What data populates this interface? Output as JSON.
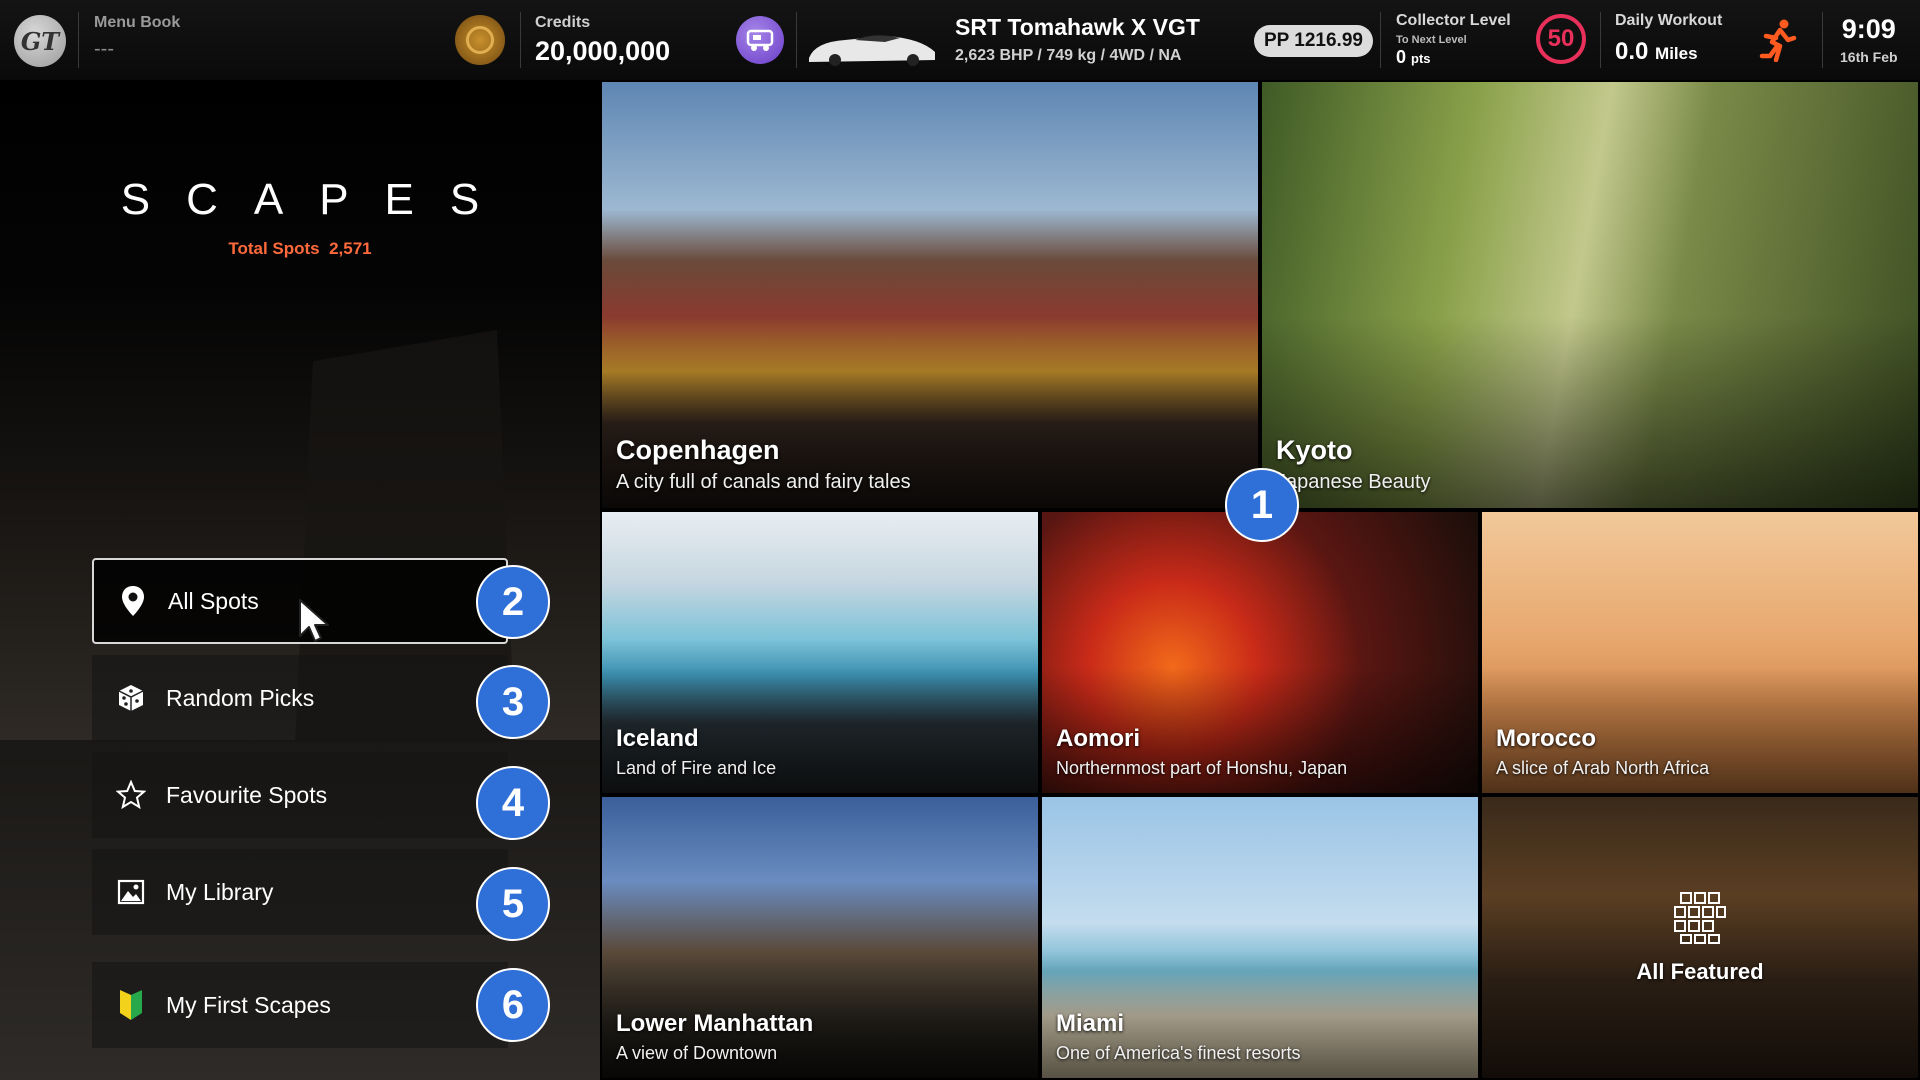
{
  "topbar": {
    "logo_text": "GT",
    "menu_book_label": "Menu Book",
    "menu_book_value": "---",
    "credits_label": "Credits",
    "credits_value": "20,000,000",
    "car_name": "SRT Tomahawk X VGT",
    "car_spec": "2,623 BHP / 749 kg / 4WD / NA",
    "pp_value": "PP 1216.99",
    "collector_label": "Collector Level",
    "collector_sub": "To Next Level",
    "collector_pts": "0",
    "collector_pts_unit": "pts",
    "collector_level": "50",
    "workout_label": "Daily Workout",
    "workout_value": "0.0",
    "workout_unit": "Miles",
    "time": "9:09",
    "date": "16th Feb"
  },
  "scapes": {
    "title": "SCAPES",
    "total_label": "Total Spots",
    "total_value": "2,571"
  },
  "menu": [
    {
      "label": "All Spots",
      "icon": "map-pin-icon",
      "badge": "2"
    },
    {
      "label": "Random Picks",
      "icon": "dice-icon",
      "badge": "3"
    },
    {
      "label": "Favourite Spots",
      "icon": "star-icon",
      "badge": "4"
    },
    {
      "label": "My Library",
      "icon": "image-icon",
      "badge": "5"
    },
    {
      "label": "My First Scapes",
      "icon": "beginner-leaf-icon",
      "badge": "6"
    }
  ],
  "tiles": [
    {
      "name": "Copenhagen",
      "desc": "A city full of canals and fairy tales"
    },
    {
      "name": "Kyoto",
      "desc": "Japanese Beauty"
    },
    {
      "name": "Iceland",
      "desc": "Land of Fire and Ice"
    },
    {
      "name": "Aomori",
      "desc": "Northernmost part of Honshu, Japan"
    },
    {
      "name": "Morocco",
      "desc": "A slice of Arab North Africa"
    },
    {
      "name": "Lower Manhattan",
      "desc": "A view of Downtown"
    },
    {
      "name": "Miami",
      "desc": "One of America's finest resorts"
    },
    {
      "name": "All Featured",
      "desc": ""
    }
  ],
  "badge_tiles": "1",
  "colors": {
    "accent_orange": "#ff6a3d",
    "badge_blue": "#2f6fd8",
    "level_pink": "#e8305a",
    "medal_gold": "#c8902c"
  }
}
